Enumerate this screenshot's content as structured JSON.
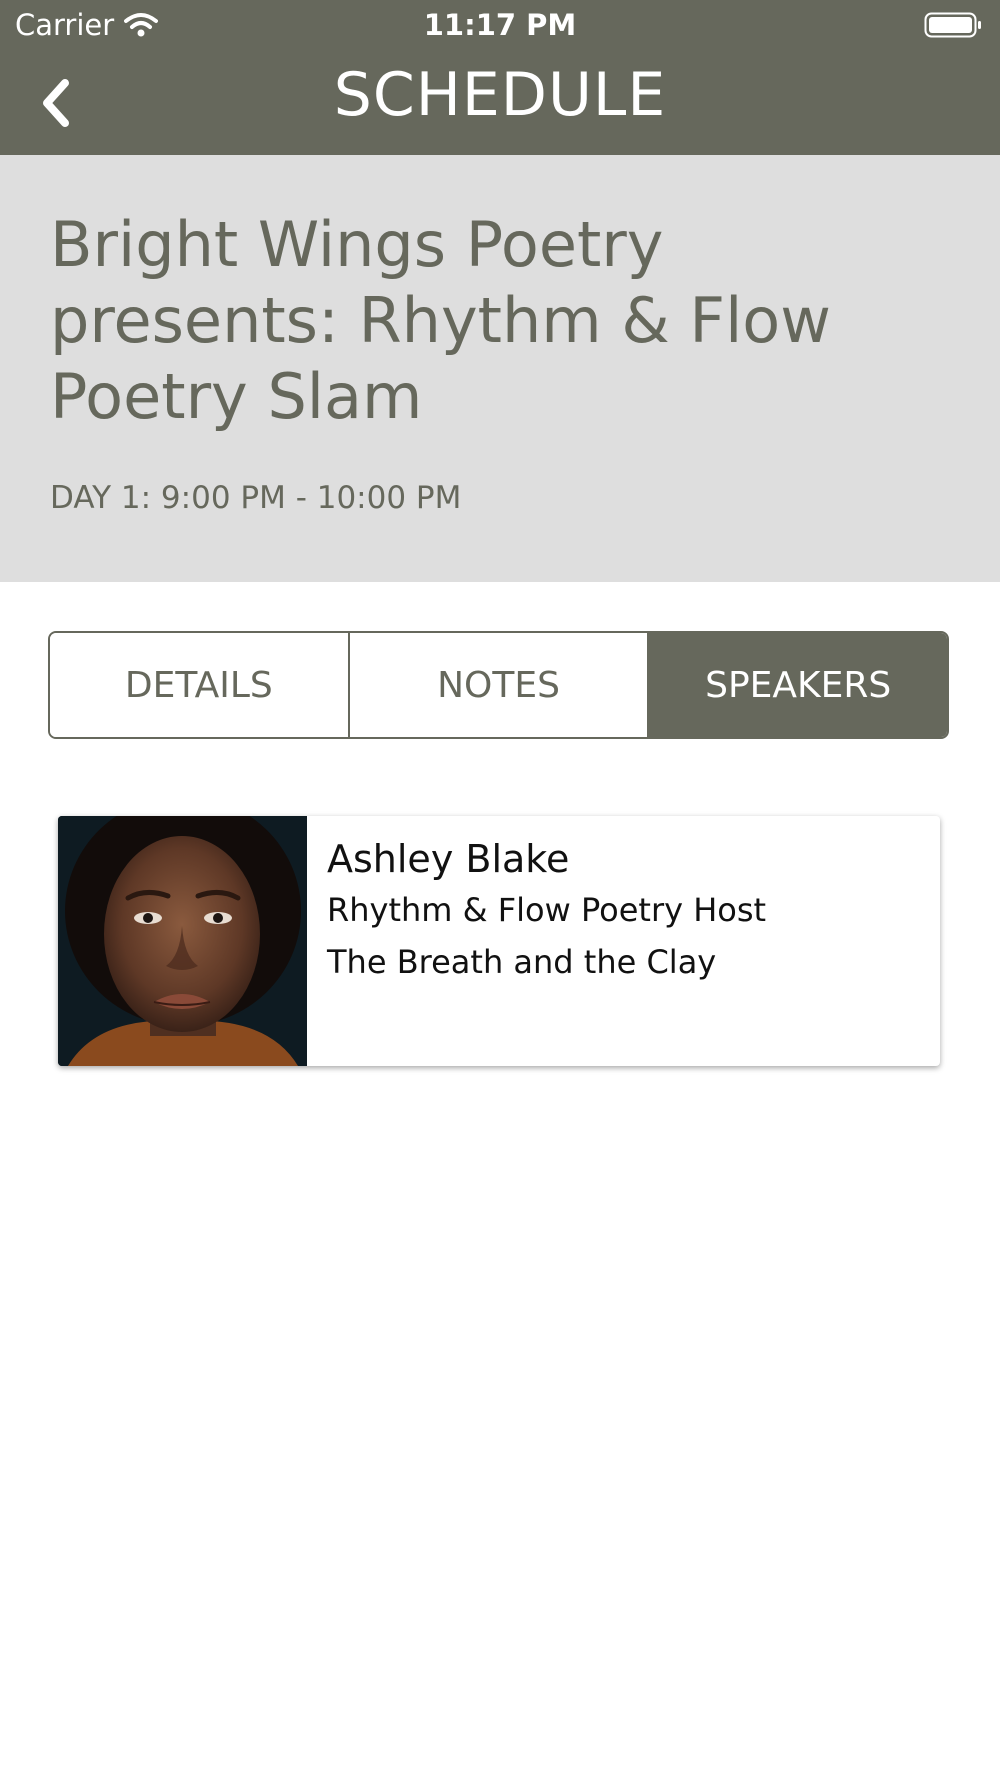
{
  "status_bar": {
    "carrier": "Carrier",
    "time": "11:17 PM"
  },
  "header": {
    "title": "SCHEDULE",
    "back_icon": "chevron-left-icon",
    "background_color": "#66685c"
  },
  "event": {
    "title": "Bright Wings Poetry presents: Rhythm & Flow Poetry Slam",
    "time": "DAY 1: 9:00 PM - 10:00 PM"
  },
  "tabs": [
    {
      "label": "DETAILS",
      "active": false
    },
    {
      "label": "NOTES",
      "active": false
    },
    {
      "label": "SPEAKERS",
      "active": true
    }
  ],
  "speakers": [
    {
      "name": "Ashley Blake",
      "role": "Rhythm & Flow Poetry Host",
      "talk": "The Breath and the Clay"
    }
  ]
}
